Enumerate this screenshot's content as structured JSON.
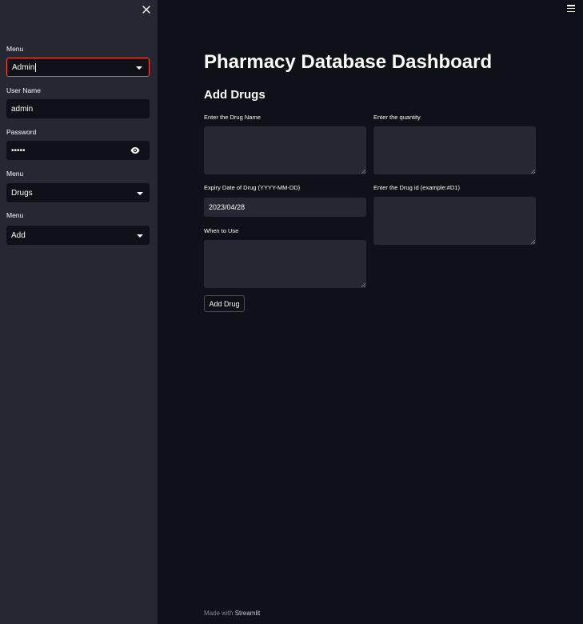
{
  "sidebar": {
    "menu1": {
      "label": "Menu",
      "value": "Admin"
    },
    "username": {
      "label": "User Name",
      "value": "admin"
    },
    "password": {
      "label": "Password",
      "value": "•••••"
    },
    "menu2": {
      "label": "Menu",
      "value": "Drugs"
    },
    "menu3": {
      "label": "Menu",
      "value": "Add"
    }
  },
  "main": {
    "title": "Pharmacy Database Dashboard",
    "section": "Add Drugs",
    "fields": {
      "drug_name": {
        "label": "Enter the Drug Name",
        "value": ""
      },
      "quantity": {
        "label": "Enter the quantity",
        "value": ""
      },
      "expiry": {
        "label": "Expiry Date of Drug (YYYY-MM-DD)",
        "value": "2023/04/28"
      },
      "drug_id": {
        "label": "Enter the Drug id (example:#D1)",
        "value": ""
      },
      "when_to_use": {
        "label": "When to Use",
        "value": ""
      }
    },
    "button_label": "Add Drug"
  },
  "footer": {
    "prefix": "Made with ",
    "brand": "Streamlit"
  },
  "colors": {
    "background": "#0e1117",
    "sidebar": "#262730",
    "focus": "#ff4b4b"
  }
}
